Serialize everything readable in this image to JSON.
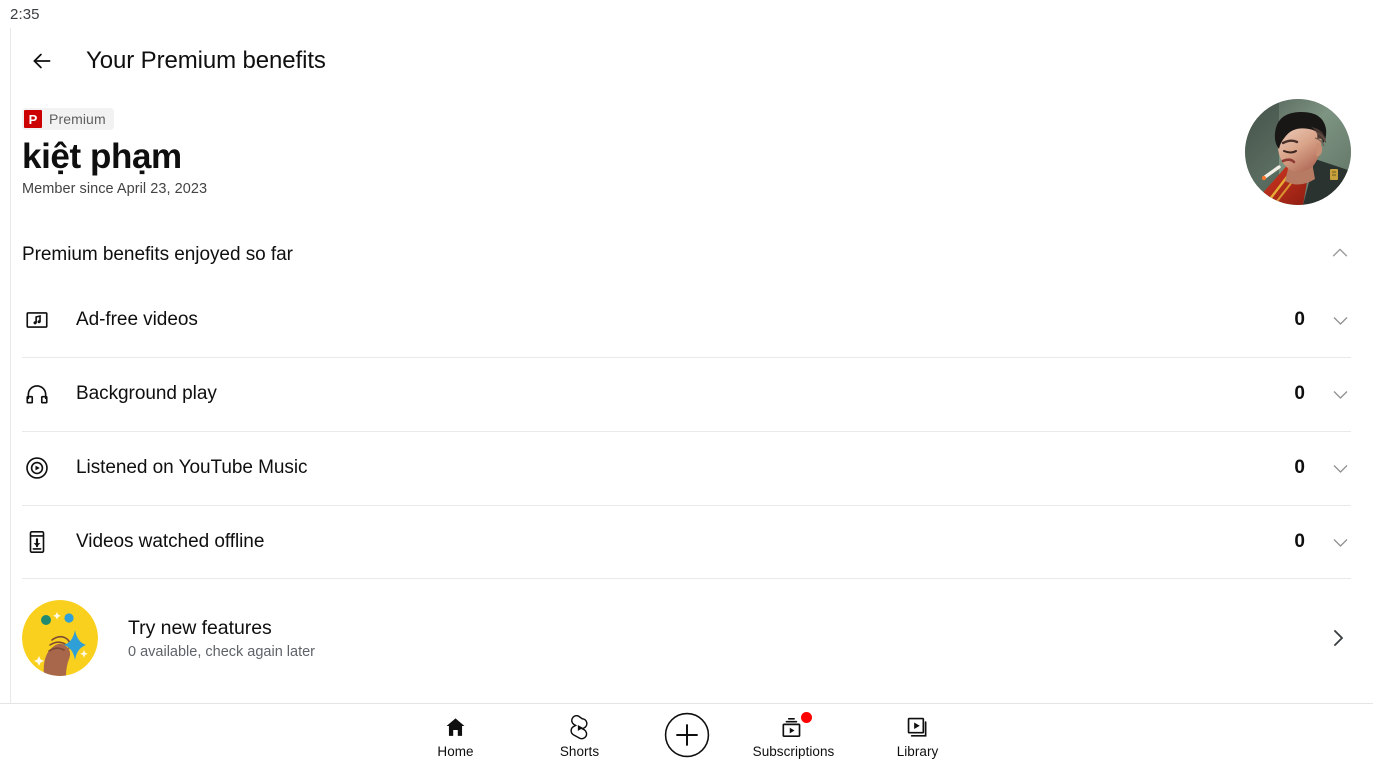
{
  "status_bar": {
    "clock": "2:35"
  },
  "app_bar": {
    "back_icon": "arrow-left-icon",
    "title": "Your Premium benefits"
  },
  "profile": {
    "badge": {
      "mark": "P",
      "label": "Premium"
    },
    "name": "kiệt phạm",
    "member_since": "Member since April 23, 2023",
    "avatar_alt": "avatar",
    "avatar_bg": "#6f7f72"
  },
  "benefits_section": {
    "title": "Premium benefits enjoyed so far",
    "collapse_icon": "chevron-up-icon",
    "rows": [
      {
        "icon": "ad-free-video-icon",
        "label": "Ad-free videos",
        "count": "0",
        "chevron": "chevron-down-icon"
      },
      {
        "icon": "headphones-icon",
        "label": "Background play",
        "count": "0",
        "chevron": "chevron-down-icon"
      },
      {
        "icon": "music-disc-icon",
        "label": "Listened on YouTube Music",
        "count": "0",
        "chevron": "chevron-down-icon"
      },
      {
        "icon": "download-phone-icon",
        "label": "Videos watched offline",
        "count": "0",
        "chevron": "chevron-down-icon"
      }
    ]
  },
  "promo": {
    "icon": "sparkle-hand-icon",
    "title": "Try new features",
    "subtitle": "0 available, check again later",
    "arrow_icon": "chevron-right-icon"
  },
  "bottom_nav": {
    "items": [
      {
        "icon": "home-icon",
        "label": "Home",
        "badge": false
      },
      {
        "icon": "shorts-icon",
        "label": "Shorts",
        "badge": false
      },
      {
        "icon": "plus-circle-icon",
        "label": "",
        "badge": false
      },
      {
        "icon": "subscriptions-icon",
        "label": "Subscriptions",
        "badge": true
      },
      {
        "icon": "library-icon",
        "label": "Library",
        "badge": false
      }
    ]
  },
  "colors": {
    "premium_red": "#cc0000",
    "badge_red": "#ff0000",
    "divider": "#e9e9e9",
    "text_primary": "#0f0f0f",
    "text_secondary": "#606060",
    "promo_yellow": "#f9d01e"
  }
}
